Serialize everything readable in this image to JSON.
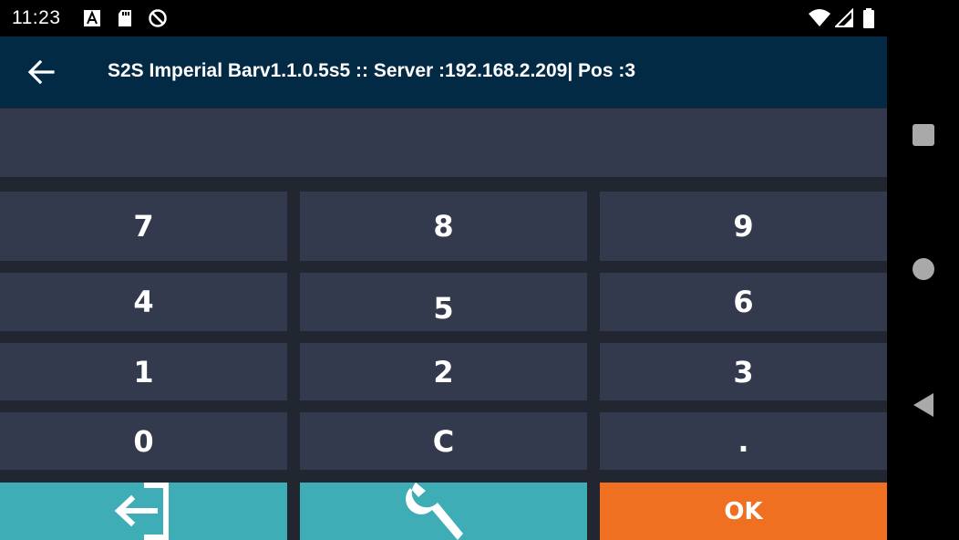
{
  "status_bar": {
    "time": "11:23",
    "left_icons": [
      "font-a-icon",
      "sd-card-icon",
      "no-sync-icon"
    ],
    "right_icons": [
      "wifi-icon",
      "signal-icon",
      "battery-icon"
    ]
  },
  "app_bar": {
    "back_icon": "back-arrow-icon",
    "title": "S2S Imperial Barv1.1.0.5s5 :: Server :192.168.2.209| Pos :3"
  },
  "display": {
    "value": ""
  },
  "keypad": {
    "rows": [
      [
        "7",
        "8",
        "9"
      ],
      [
        "4",
        "5",
        "6"
      ],
      [
        "1",
        "2",
        "3"
      ],
      [
        "0",
        "C",
        "."
      ]
    ]
  },
  "actions": {
    "exit_icon": "logout-icon",
    "settings_icon": "wrench-icon",
    "ok_label": "OK"
  },
  "nav_bar": {
    "buttons": [
      "recents-icon",
      "home-icon",
      "back-icon"
    ]
  },
  "colors": {
    "app_bar": "#032a45",
    "background": "#222631",
    "key": "#333a4d",
    "teal": "#3eadb5",
    "orange": "#f07022"
  }
}
